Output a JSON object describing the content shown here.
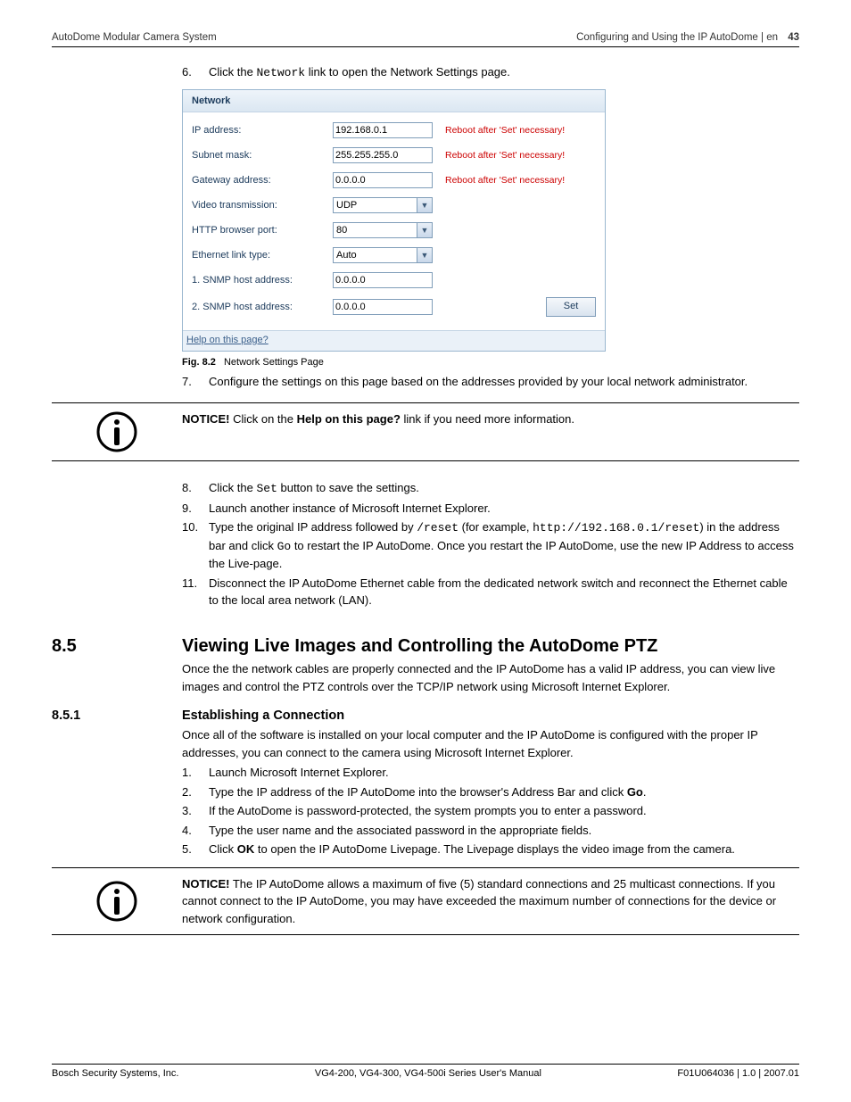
{
  "header": {
    "left": "AutoDome Modular Camera System",
    "right": "Configuring and Using the IP AutoDome | en",
    "pagenum": "43"
  },
  "steps_top": {
    "s6": {
      "num": "6.",
      "pre": "Click the ",
      "code": "Network",
      "post": " link to open the Network Settings page."
    }
  },
  "screenshot": {
    "title": "Network",
    "rows": {
      "ip": {
        "label": "IP address:",
        "value": "192.168.0.1",
        "warn": "Reboot after 'Set' necessary!"
      },
      "subnet": {
        "label": "Subnet mask:",
        "value": "255.255.255.0",
        "warn": "Reboot after 'Set' necessary!"
      },
      "gateway": {
        "label": "Gateway address:",
        "value": "0.0.0.0",
        "warn": "Reboot after 'Set' necessary!"
      },
      "video": {
        "label": "Video transmission:",
        "value": "UDP"
      },
      "http": {
        "label": "HTTP browser port:",
        "value": "80"
      },
      "eth": {
        "label": "Ethernet link type:",
        "value": "Auto"
      },
      "snmp1": {
        "label": "1. SNMP host address:",
        "value": "0.0.0.0"
      },
      "snmp2": {
        "label": "2. SNMP host address:",
        "value": "0.0.0.0"
      }
    },
    "set_btn": "Set",
    "help_link": "Help on this page?"
  },
  "fig": {
    "label": "Fig. 8.2",
    "caption": "Network Settings Page"
  },
  "steps_mid": {
    "s7": {
      "num": "7.",
      "text": "Configure the settings on this page based on the addresses provided by your local network administrator."
    }
  },
  "notice1": {
    "bold": "NOTICE!",
    "pre": " Click on the ",
    "link": "Help on this page?",
    "post": " link if you need more information."
  },
  "steps_bottom": {
    "s8": {
      "num": "8.",
      "pre": "Click the ",
      "code": "Set",
      "post": " button to save the settings."
    },
    "s9": {
      "num": "9.",
      "text": "Launch another instance of Microsoft Internet Explorer."
    },
    "s10": {
      "num": "10.",
      "t1": "Type the original IP address followed by ",
      "c1": "/reset",
      "t2": " (for example, ",
      "c2": "http://192.168.0.1/reset",
      "t3": ") in the address bar and click ",
      "c3": "Go",
      "t4": " to restart the IP AutoDome. Once you restart the IP AutoDome, use the new IP Address to access the ",
      "live": "Live-page",
      "t5": "."
    },
    "s11": {
      "num": "11.",
      "text": "Disconnect the IP AutoDome Ethernet cable from the dedicated network switch and reconnect the Ethernet cable to the local area network (LAN)."
    }
  },
  "section85": {
    "num": "8.5",
    "title": "Viewing Live Images and Controlling the AutoDome PTZ",
    "para": "Once the the network cables are properly connected and the IP AutoDome has a valid IP address, you can view live images and control the PTZ controls over the TCP/IP network using Microsoft Internet Explorer."
  },
  "section851": {
    "num": "8.5.1",
    "title": "Establishing a Connection",
    "para": "Once all of the software is installed on your local computer and the IP AutoDome is configured with the proper IP addresses, you can connect to the camera using Microsoft Internet Explorer.",
    "steps": {
      "s1": {
        "num": "1.",
        "text": "Launch Microsoft Internet Explorer."
      },
      "s2": {
        "num": "2.",
        "pre": "Type the IP address of the IP AutoDome into the browser's Address Bar and click ",
        "bold": "Go",
        "post": "."
      },
      "s3": {
        "num": "3.",
        "text": "If the AutoDome is password-protected, the system prompts you to enter a password."
      },
      "s4": {
        "num": "4.",
        "text": "Type the user name and the associated password in the appropriate fields."
      },
      "s5": {
        "num": "5.",
        "pre": "Click ",
        "bold": "OK",
        "post": " to open the IP AutoDome Livepage. The Livepage displays the video image from the camera."
      }
    }
  },
  "notice2": {
    "bold": "NOTICE!",
    "text": " The IP AutoDome allows a maximum of five (5) standard connections and 25 multicast connections. If you cannot connect to the IP AutoDome, you may have exceeded the maximum number of connections for the device or network configuration."
  },
  "footer": {
    "left": "Bosch Security Systems, Inc.",
    "center": "VG4-200, VG4-300, VG4-500i Series User's Manual",
    "right": "F01U064036 | 1.0 | 2007.01"
  }
}
